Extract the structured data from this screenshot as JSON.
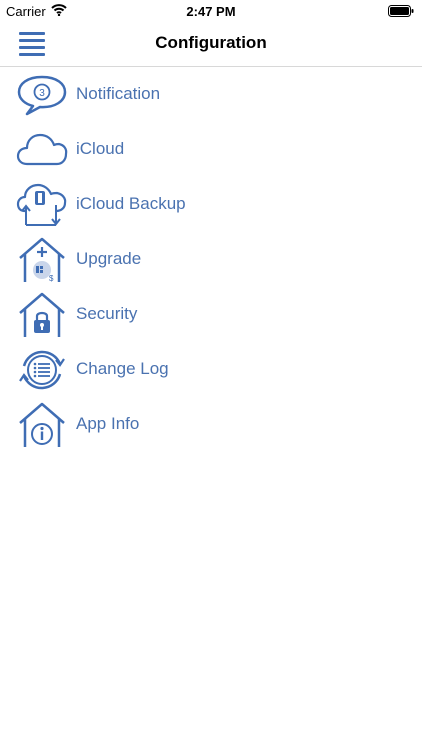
{
  "status_bar": {
    "carrier": "Carrier",
    "time": "2:47 PM",
    "icons": [
      "wifi-icon",
      "battery-icon"
    ]
  },
  "nav": {
    "title": "Configuration",
    "menu_icon": "hamburger-menu-icon"
  },
  "colors": {
    "accent": "#3f6db4",
    "label": "#4a72b0",
    "divider": "#d8d8d8"
  },
  "menu_items": [
    {
      "label": "Notification",
      "icon": "notification-speech-bubble-icon",
      "badge": "3"
    },
    {
      "label": "iCloud",
      "icon": "icloud-icon"
    },
    {
      "label": "iCloud Backup",
      "icon": "icloud-backup-icon"
    },
    {
      "label": "Upgrade",
      "icon": "upgrade-house-icon"
    },
    {
      "label": "Security",
      "icon": "security-lock-house-icon"
    },
    {
      "label": "Change Log",
      "icon": "change-log-list-icon"
    },
    {
      "label": "App Info",
      "icon": "app-info-house-icon"
    }
  ]
}
